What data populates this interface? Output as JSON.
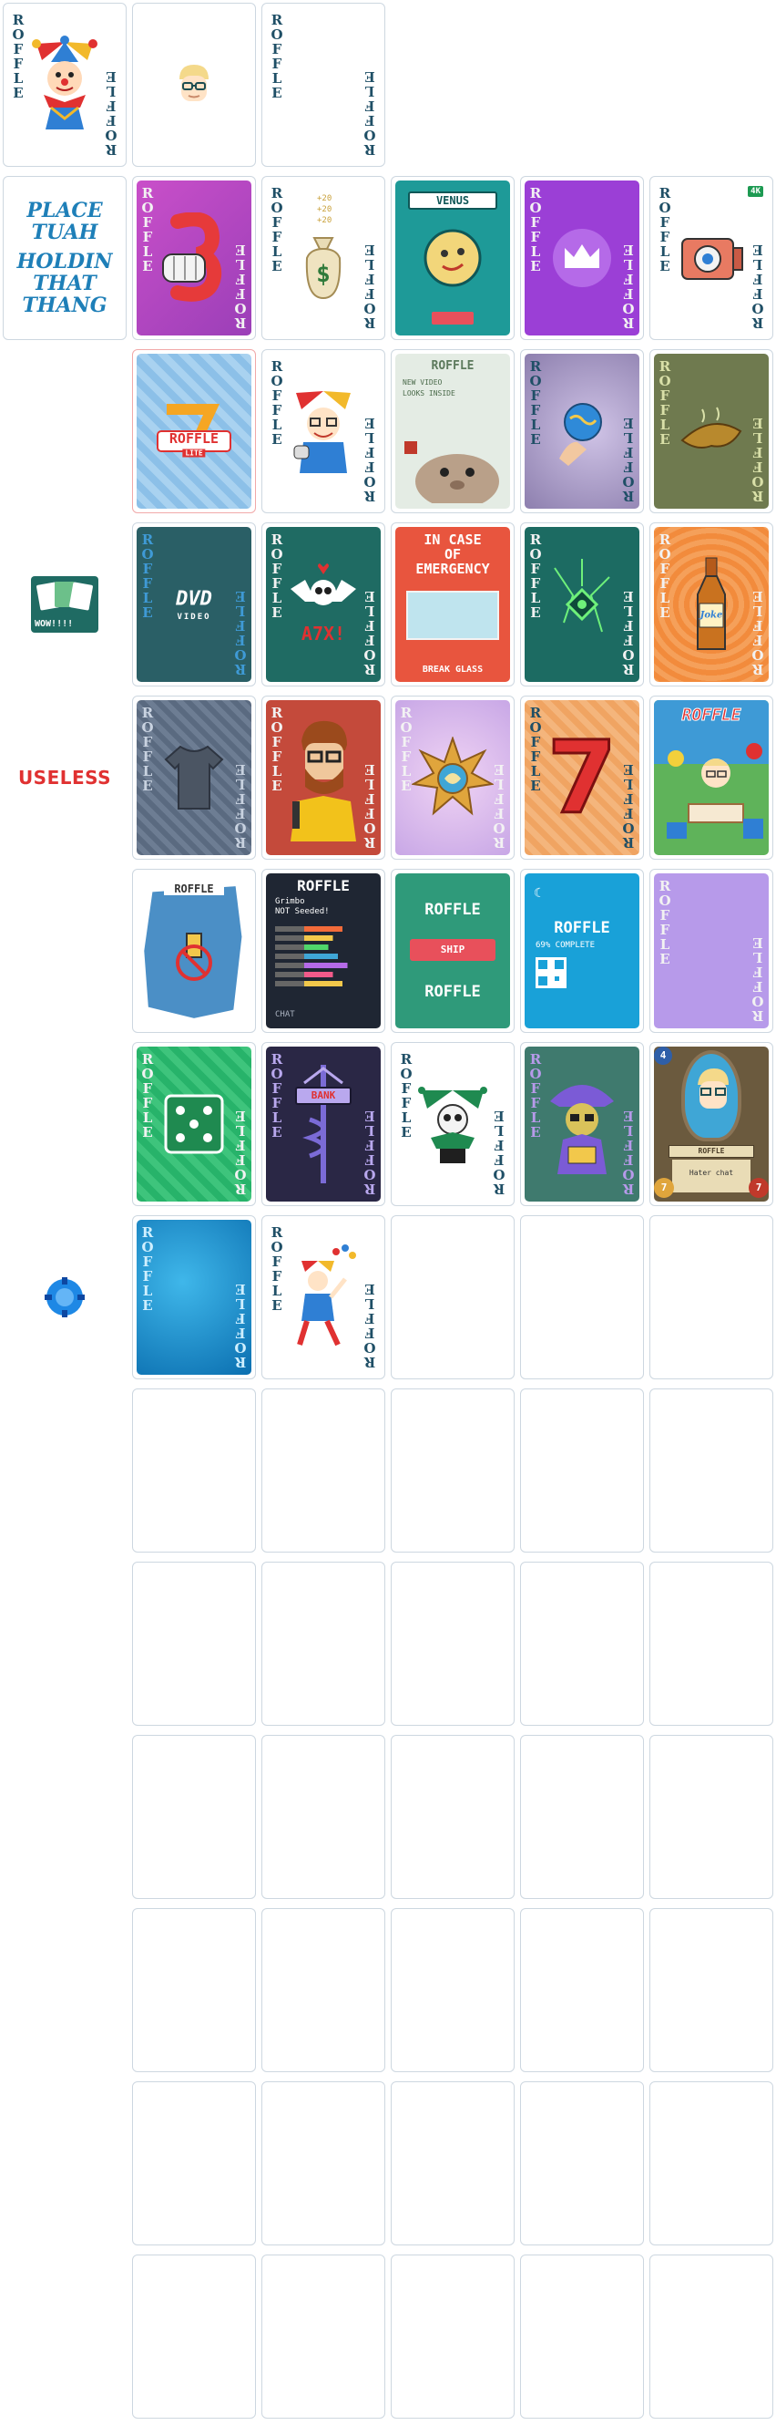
{
  "palette": {
    "border": "#cdd7e0",
    "roffle_text": "#1f4f66",
    "useless_red": "#e03131",
    "handwriting_blue": "#1e7fb8"
  },
  "rows": [
    {
      "side": {
        "kind": "card",
        "name": "jester-card",
        "label": "ROFFLE"
      },
      "cells": [
        {
          "name": "avatar-head",
          "kind": "avatar"
        },
        {
          "name": "blank-roffle-card",
          "kind": "blank",
          "label": "ROFFLE"
        }
      ]
    },
    {
      "side": {
        "kind": "text",
        "name": "place-tuah-card",
        "lines": [
          "PLACE",
          "TUAH",
          "HOLDIN",
          "THAT",
          "THANG"
        ]
      },
      "cells": [
        {
          "name": "card-fist-three",
          "label": "ROFFLE"
        },
        {
          "name": "card-money-bag",
          "label": "ROFFLE",
          "icon_text": "$",
          "small": [
            "+20",
            "+20",
            "+20"
          ]
        },
        {
          "name": "card-venus",
          "title": "VENUS"
        },
        {
          "name": "card-crown",
          "label": "ROFFLE"
        },
        {
          "name": "card-4k-camera",
          "label": "ROFFLE",
          "badge": "4K"
        }
      ]
    },
    {
      "side": {
        "kind": "empty"
      },
      "cells": [
        {
          "name": "card-roffle-lite",
          "title": "ROFFLE",
          "subtitle": "LITE"
        },
        {
          "name": "card-jester-face",
          "label": "ROFFLE"
        },
        {
          "name": "card-new-video",
          "title": "ROFFLE",
          "lines": [
            "NEW VIDEO",
            "LOOKS INSIDE"
          ]
        },
        {
          "name": "card-globe-swirl",
          "label": "ROFFLE"
        },
        {
          "name": "card-banana",
          "label": "ROFFLE"
        }
      ]
    },
    {
      "side": {
        "kind": "image",
        "name": "wow-thumbnail",
        "label": "WOW!!!!"
      },
      "cells": [
        {
          "name": "card-dvd",
          "label": "ROFFLE",
          "title": "DVD",
          "subtitle": "VIDEO"
        },
        {
          "name": "card-skull-a7x",
          "label": "ROFFLE",
          "title": "A7X!"
        },
        {
          "name": "card-emergency",
          "lines": [
            "IN CASE",
            "OF",
            "EMERGENCY"
          ],
          "footer": "BREAK GLASS"
        },
        {
          "name": "card-green-crack",
          "label": "ROFFLE"
        },
        {
          "name": "card-joke-bottle",
          "label": "ROFFLE",
          "title": "Joke"
        }
      ]
    },
    {
      "side": {
        "kind": "text",
        "name": "useless-label",
        "text": "USELESS"
      },
      "cells": [
        {
          "name": "card-shirt",
          "label": "ROFFLE"
        },
        {
          "name": "card-bearded-man",
          "label": "ROFFLE"
        },
        {
          "name": "card-orange-sun",
          "label": "ROFFLE"
        },
        {
          "name": "card-seven",
          "label": "ROFFLE",
          "title": "7"
        },
        {
          "name": "card-party",
          "title": "ROFFLE"
        }
      ]
    },
    {
      "side": {
        "kind": "empty"
      },
      "cells": [
        {
          "name": "card-torn-roffle",
          "title": "ROFFLE"
        },
        {
          "name": "card-chat-list",
          "title": "ROFFLE",
          "lines": [
            "Grimbo",
            "NOT Seeded!"
          ],
          "footer": "CHAT"
        },
        {
          "name": "card-ship",
          "title": "ROFFLE",
          "middle": "SHIP",
          "footer": "ROFFLE"
        },
        {
          "name": "card-qr-complete",
          "title": "ROFFLE",
          "lines": [
            "69% COMPLETE"
          ]
        },
        {
          "name": "card-purple-plain",
          "label": "ROFFLE"
        }
      ]
    },
    {
      "side": {
        "kind": "empty"
      },
      "cells": [
        {
          "name": "card-dice",
          "label": "ROFFLE"
        },
        {
          "name": "card-bank-sign",
          "label": "ROFFLE",
          "title": "BANK"
        },
        {
          "name": "card-green-jester",
          "label": "ROFFLE"
        },
        {
          "name": "card-mage",
          "label": "ROFFLE"
        },
        {
          "name": "card-hater-chat",
          "title": "ROFFLE",
          "footer": "Hater chat",
          "cost": "4",
          "attack": "7",
          "health": "7"
        }
      ]
    },
    {
      "side": {
        "kind": "image",
        "name": "blue-chip-token"
      },
      "cells": [
        {
          "name": "card-blue-ocean",
          "label": "ROFFLE"
        },
        {
          "name": "card-juggler-jester",
          "label": "ROFFLE"
        },
        {
          "name": "empty-slot"
        },
        {
          "name": "empty-slot"
        },
        {
          "name": "empty-slot"
        }
      ]
    }
  ],
  "empty_rows": 7
}
